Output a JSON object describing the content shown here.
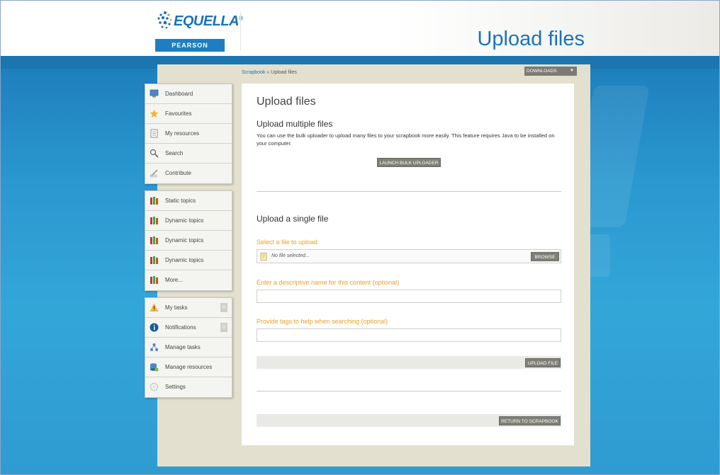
{
  "header": {
    "logo_word": "EQUELLA",
    "logo_trademark": "®",
    "logo_band": "PEARSON",
    "page_heading": "Upload files",
    "colors": {
      "brand_blue": "#1a73b8",
      "accent_orange": "#e8a12a"
    }
  },
  "breadcrumb": {
    "parent": "Scrapbook",
    "separator": " » ",
    "current": "Upload files"
  },
  "downloads": {
    "label": "DOWNLOADS",
    "arrow": "▼"
  },
  "menu": {
    "group1": [
      {
        "label": "Dashboard",
        "icon": "dashboard-icon"
      },
      {
        "label": "Favourites",
        "icon": "star-icon"
      },
      {
        "label": "My resources",
        "icon": "document-icon"
      },
      {
        "label": "Search",
        "icon": "search-icon"
      },
      {
        "label": "Contribute",
        "icon": "pencil-icon"
      }
    ],
    "group2": [
      {
        "label": "Static topics",
        "icon": "books-icon"
      },
      {
        "label": "Dynamic topics",
        "icon": "books-icon"
      },
      {
        "label": "Dynamic topics",
        "icon": "books-icon"
      },
      {
        "label": "Dynamic topics",
        "icon": "books-icon"
      },
      {
        "label": "More...",
        "icon": "books-icon"
      }
    ],
    "group3": [
      {
        "label": "My tasks",
        "icon": "warning-icon",
        "count": "0"
      },
      {
        "label": "Notifications",
        "icon": "info-icon",
        "count": "0"
      },
      {
        "label": "Manage tasks",
        "icon": "workflow-icon"
      },
      {
        "label": "Manage resources",
        "icon": "database-icon"
      },
      {
        "label": "Settings",
        "icon": "gear-icon"
      }
    ]
  },
  "content": {
    "title": "Upload files",
    "multi": {
      "heading": "Upload multiple files",
      "description": "You can use the bulk uploader to upload many files to your scrapbook more easily. This feature requires Java to be installed on your computer.",
      "launch_button": "LAUNCH BULK UPLOADER"
    },
    "single": {
      "heading": "Upload a single file",
      "select_label": "Select a file to upload",
      "file_placeholder": "No file selected...",
      "browse_button": "BROWSE",
      "name_label": "Enter a descriptive name for this content (optional)",
      "name_value": "",
      "tags_label": "Provide tags to help when searching (optional)",
      "tags_value": "",
      "upload_button": "UPLOAD FILE"
    },
    "return_button": "RETURN TO SCRAPBOOK"
  }
}
